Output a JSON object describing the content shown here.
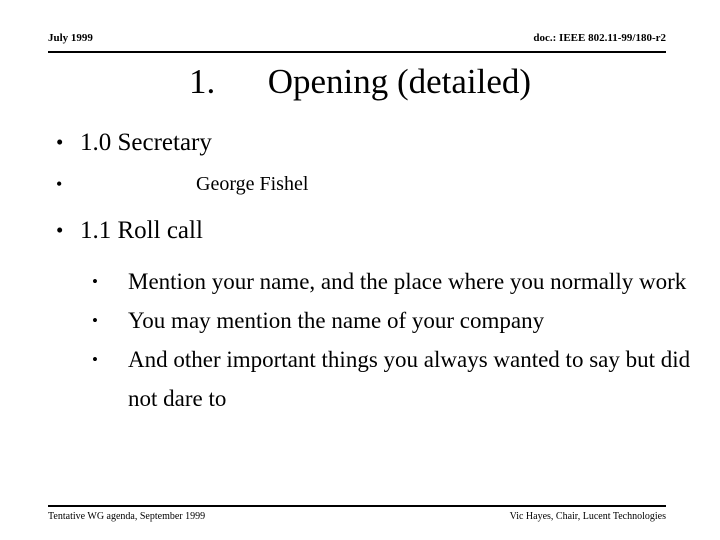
{
  "header": {
    "left": "July 1999",
    "right": "doc.: IEEE 802.11-99/180-r2"
  },
  "title": {
    "number": "1.",
    "text": "1.   Opening (detailed)",
    "heading": "Opening (detailed)"
  },
  "body": {
    "bullet_glyph": "•",
    "items": [
      {
        "level": 1,
        "text": "1.0 Secretary"
      },
      {
        "level": 2,
        "text": "George Fishel"
      },
      {
        "level": 1,
        "text": "1.1 Roll call"
      },
      {
        "level": 3,
        "text": "Mention your name, and the place where you normally work"
      },
      {
        "level": 3,
        "text": "You may mention the name of your company"
      },
      {
        "level": 3,
        "text": "And other important things you always wanted to say but did not dare to"
      }
    ]
  },
  "footer": {
    "left": "Tentative WG agenda, September 1999",
    "right": "Vic Hayes, Chair, Lucent Technologies"
  },
  "colors": {
    "text": "#000000",
    "background": "#ffffff",
    "rule": "#000000"
  }
}
